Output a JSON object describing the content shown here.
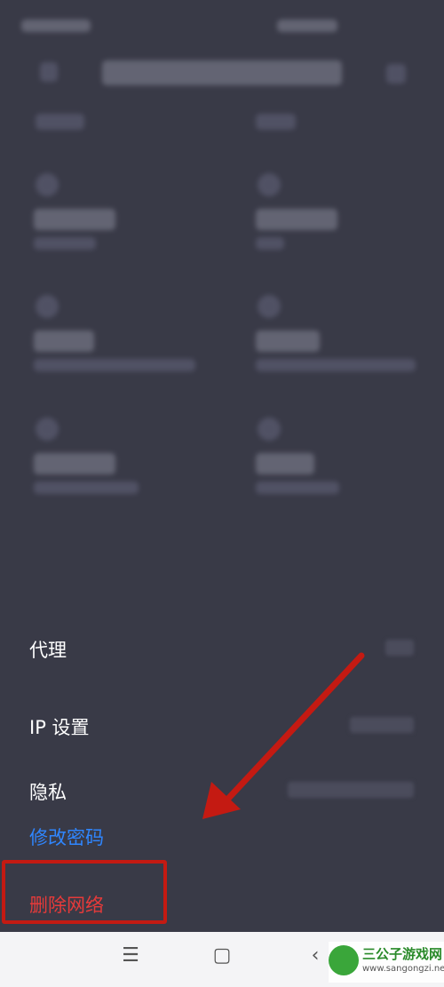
{
  "settings_rows": [
    {
      "label": "代理"
    },
    {
      "label": "IP 设置"
    },
    {
      "label": "隐私"
    }
  ],
  "actions": {
    "change_password": "修改密码",
    "delete_network": "删除网络"
  },
  "navbar": {
    "menu_icon": "☰",
    "home_icon": "▢",
    "back_icon": "‹"
  },
  "watermark": {
    "brand": "三公子游戏网",
    "url": "www.sangongzi.net"
  },
  "colors": {
    "background": "#393a47",
    "link_blue": "#2f86ff",
    "delete_red": "#e63a3a",
    "annotation_red": "#c41a12"
  }
}
